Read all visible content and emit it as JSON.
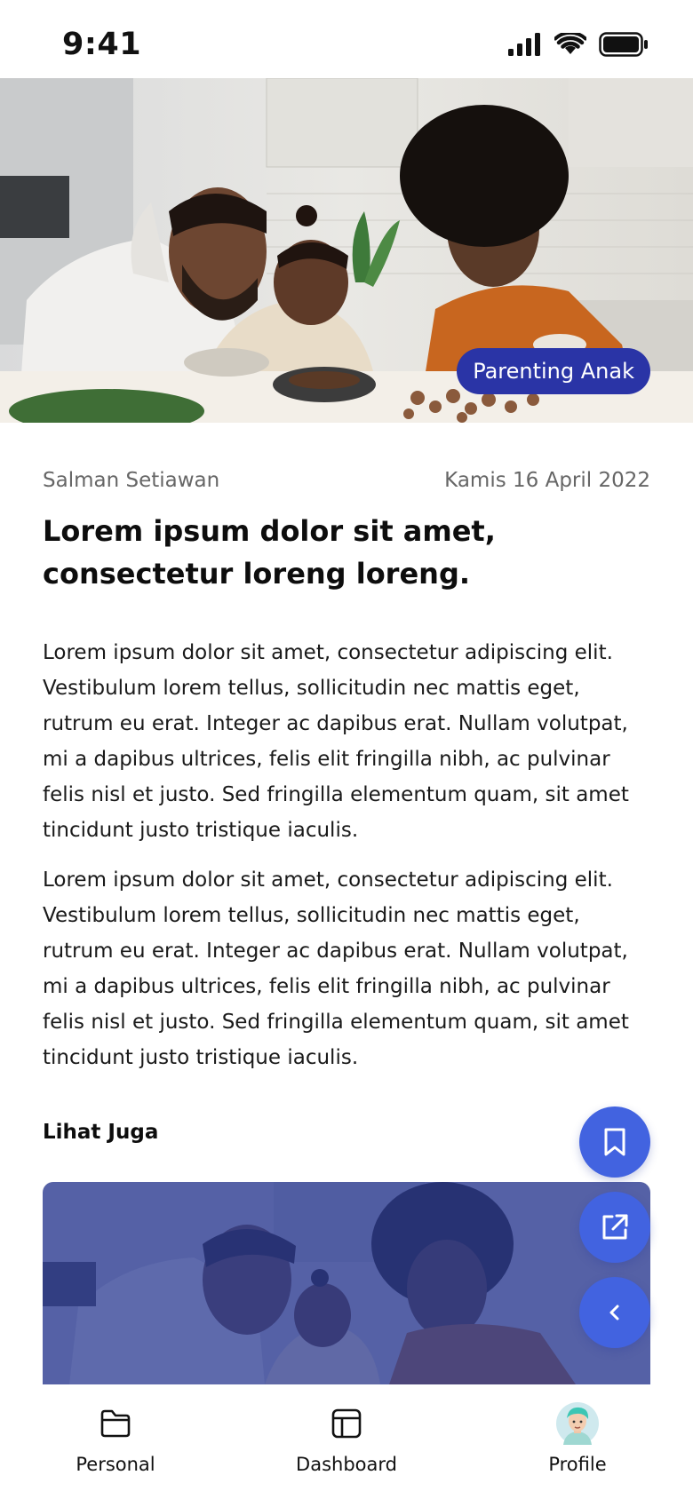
{
  "status_bar": {
    "time": "9:41",
    "signal_icon": "cellular-signal-icon",
    "wifi_icon": "wifi-icon",
    "battery_icon": "battery-icon"
  },
  "hero": {
    "image": "family-cooking-photo",
    "category": "Parenting Anak"
  },
  "article": {
    "author": "Salman Setiawan",
    "date": "Kamis 16 April 2022",
    "title": "Lorem ipsum dolor sit amet, consectetur loreng loreng.",
    "paragraphs": [
      "Lorem ipsum dolor sit amet, consectetur adipiscing elit. Vestibulum lorem tellus, sollicitudin nec mattis eget, rutrum eu erat. Integer ac dapibus erat. Nullam volutpat, mi a dapibus ultrices, felis elit fringilla nibh, ac pulvinar felis nisl et justo. Sed fringilla elementum quam, sit amet tincidunt justo tristique iaculis.",
      "Lorem ipsum dolor sit amet, consectetur adipiscing elit. Vestibulum lorem tellus, sollicitudin nec mattis eget, rutrum eu erat. Integer ac dapibus erat. Nullam volutpat, mi a dapibus ultrices, felis elit fringilla nibh, ac pulvinar felis nisl et justo. Sed fringilla elementum quam, sit amet tincidunt justo tristique iaculis."
    ]
  },
  "see_also": {
    "heading": "Lihat Juga",
    "card_image": "family-cooking-photo-blue-overlay"
  },
  "fabs": {
    "bookmark_icon": "bookmark-icon",
    "share_icon": "external-share-icon",
    "back_icon": "chevron-left-icon"
  },
  "bottom_nav": {
    "items": [
      {
        "label": "Personal",
        "icon": "folder-icon"
      },
      {
        "label": "Dashboard",
        "icon": "layout-icon"
      },
      {
        "label": "Profile",
        "icon": "avatar"
      }
    ]
  },
  "colors": {
    "accent": "#4263e0",
    "badge": "#2a34a6",
    "overlay": "#2e3f9a"
  }
}
